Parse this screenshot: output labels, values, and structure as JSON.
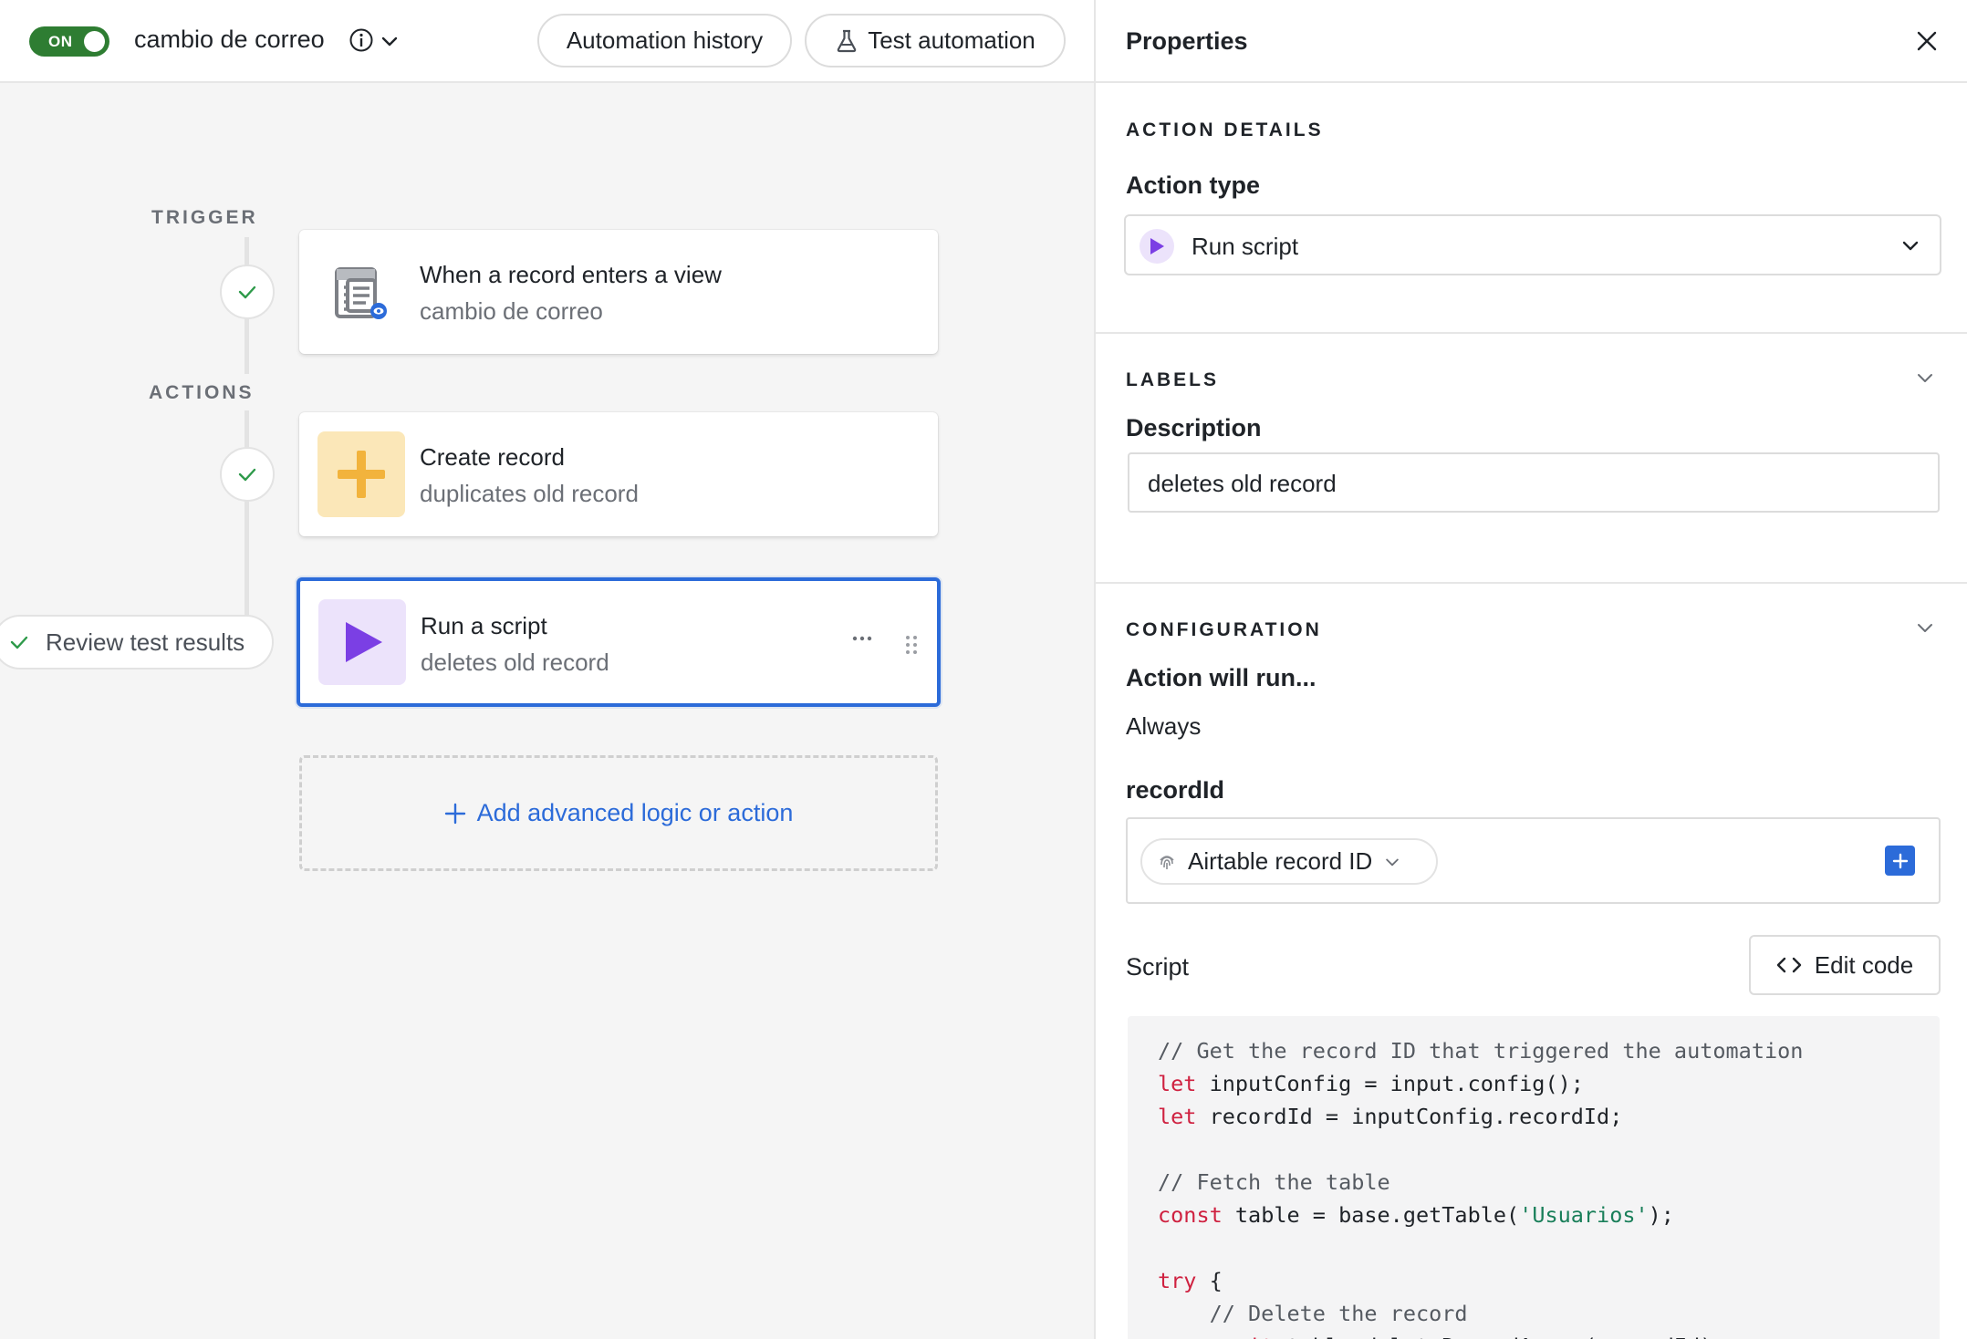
{
  "topbar": {
    "toggle_label": "ON",
    "automation_name": "cambio de correo",
    "history_button": "Automation history",
    "test_button": "Test automation"
  },
  "flow": {
    "trigger_label": "TRIGGER",
    "actions_label": "ACTIONS",
    "trigger_card": {
      "title": "When a record enters a view",
      "subtitle": "cambio de correo",
      "icon": "record-view-icon"
    },
    "action_cards": [
      {
        "title": "Create record",
        "subtitle": "duplicates old record",
        "icon": "plus-icon",
        "icon_color": "#f2b33c"
      },
      {
        "title": "Run a script",
        "subtitle": "deletes old record",
        "icon": "play-icon",
        "icon_color": "#7b3fe4"
      }
    ],
    "review_button": "Review test results",
    "add_action": "Add advanced logic or action"
  },
  "properties": {
    "title": "Properties",
    "action_details": {
      "section": "ACTION DETAILS",
      "action_type_label": "Action type",
      "action_type_value": "Run script"
    },
    "labels": {
      "section": "LABELS",
      "description_label": "Description",
      "description_value": "deletes old record"
    },
    "configuration": {
      "section": "CONFIGURATION",
      "run_condition_label": "Action will run...",
      "run_condition_value": "Always",
      "input_name": "recordId",
      "input_token": "Airtable record ID",
      "script_label": "Script",
      "edit_code_button": "Edit code"
    },
    "code_lines": [
      [
        {
          "t": "// Get the record ID that triggered the automation",
          "c": "com"
        }
      ],
      [
        {
          "t": "let",
          "c": "kw"
        },
        {
          "t": " inputConfig = input.config();",
          "c": ""
        }
      ],
      [
        {
          "t": "let",
          "c": "kw"
        },
        {
          "t": " recordId = inputConfig.recordId;",
          "c": ""
        }
      ],
      [
        {
          "t": "",
          "c": ""
        }
      ],
      [
        {
          "t": "// Fetch the table",
          "c": "com"
        }
      ],
      [
        {
          "t": "const",
          "c": "kw"
        },
        {
          "t": " table = base.getTable(",
          "c": ""
        },
        {
          "t": "'Usuarios'",
          "c": "str"
        },
        {
          "t": ");",
          "c": ""
        }
      ],
      [
        {
          "t": "",
          "c": ""
        }
      ],
      [
        {
          "t": "try",
          "c": "kw"
        },
        {
          "t": " {",
          "c": ""
        }
      ],
      [
        {
          "t": "    // Delete the record",
          "c": "com"
        }
      ],
      [
        {
          "t": "    ",
          "c": ""
        },
        {
          "t": "await",
          "c": "kw"
        },
        {
          "t": " table.deleteRecordAsync(recordId);",
          "c": ""
        }
      ]
    ]
  },
  "colors": {
    "toggle_on": "#2e7d32",
    "accent_blue": "#2c6bd9",
    "script_purple": "#7b3fe4",
    "create_yellow": "#f2b33c"
  }
}
